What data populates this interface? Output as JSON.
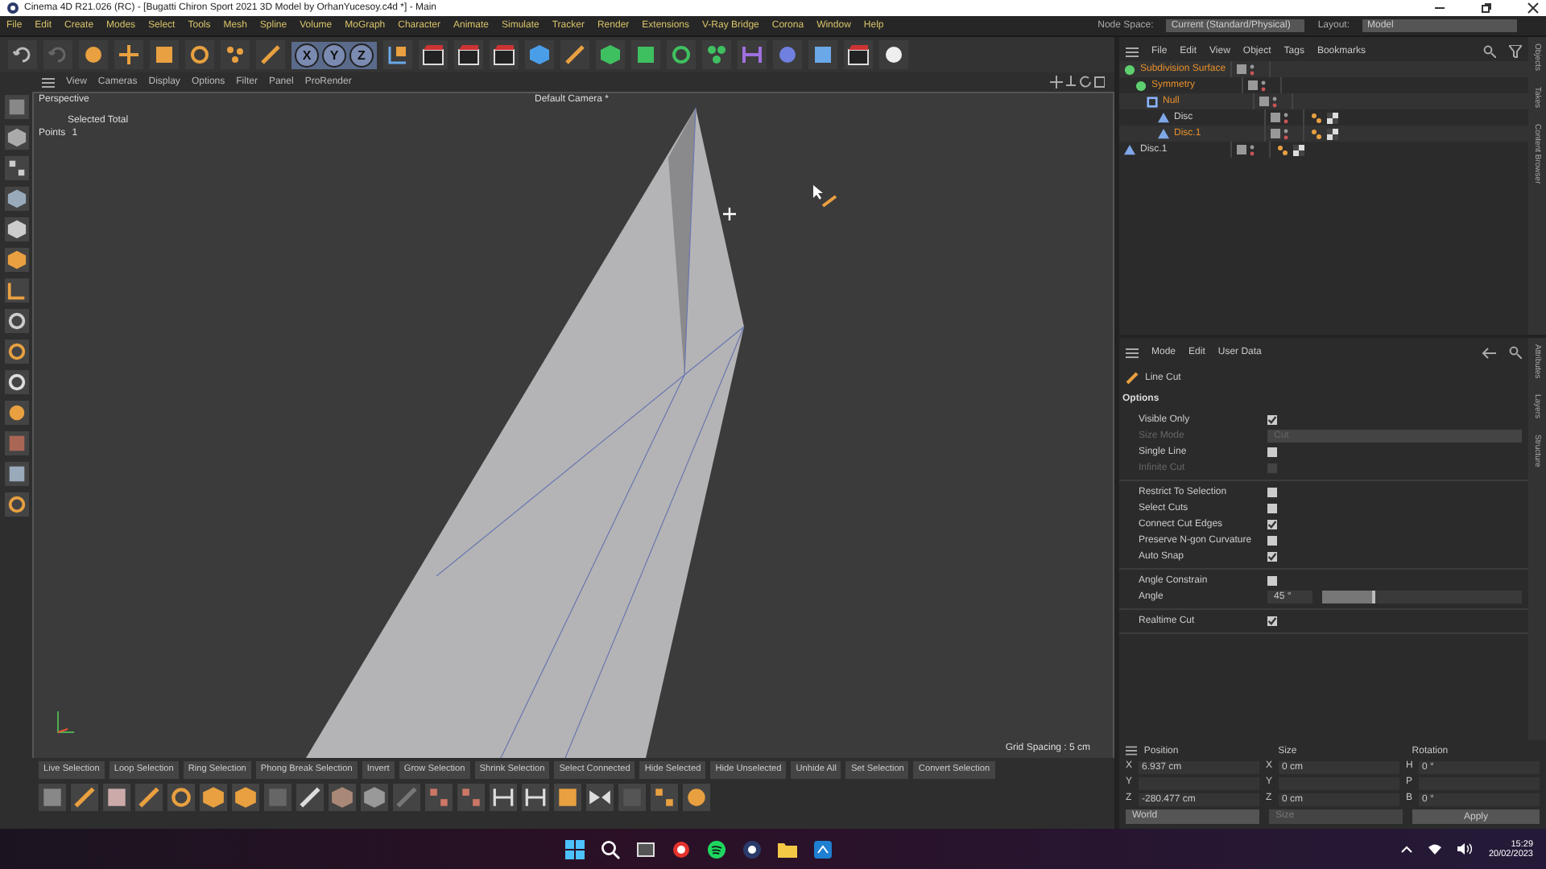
{
  "window": {
    "title": "Cinema 4D R21.026 (RC) - [Bugatti Chiron Sport 2021 3D Model by OrhanYucesoy.c4d *] - Main"
  },
  "menu": [
    "File",
    "Edit",
    "Create",
    "Modes",
    "Select",
    "Tools",
    "Mesh",
    "Spline",
    "Volume",
    "MoGraph",
    "Character",
    "Animate",
    "Simulate",
    "Tracker",
    "Render",
    "Extensions",
    "V-Ray Bridge",
    "Corona",
    "Window",
    "Help"
  ],
  "node_space": {
    "label": "Node Space:",
    "value": "Current (Standard/Physical)"
  },
  "layout": {
    "label": "Layout:",
    "value": "Model"
  },
  "axis_buttons": [
    "X",
    "Y",
    "Z"
  ],
  "viewport": {
    "menu": [
      "View",
      "Cameras",
      "Display",
      "Options",
      "Filter",
      "Panel",
      "ProRender"
    ],
    "view_name": "Perspective",
    "camera": "Default Camera *",
    "stats": [
      {
        "label": "Selected Total"
      },
      {
        "label": "Points",
        "value": "1"
      }
    ],
    "grid_spacing": "Grid Spacing : 5 cm"
  },
  "selection_tools": [
    "Live Selection",
    "Loop Selection",
    "Ring Selection",
    "Phong Break Selection",
    "Invert",
    "Grow Selection",
    "Shrink Selection",
    "Select Connected",
    "Hide Selected",
    "Hide Unselected",
    "Unhide All",
    "Set Selection",
    "Convert Selection"
  ],
  "objects": {
    "menu": [
      "File",
      "Edit",
      "View",
      "Object",
      "Tags",
      "Bookmarks"
    ],
    "tree": [
      {
        "name": "Subdivision Surface",
        "kind": "subdivision",
        "selected": true,
        "tagged": false,
        "children": [
          {
            "name": "Symmetry",
            "kind": "symmetry",
            "selected": true,
            "tagged": false,
            "children": [
              {
                "name": "Null",
                "kind": "null",
                "selected": true,
                "tagged": false,
                "children": [
                  {
                    "name": "Disc",
                    "kind": "disc",
                    "selected": false,
                    "tagged": true
                  },
                  {
                    "name": "Disc.1",
                    "kind": "disc",
                    "selected": true,
                    "tagged": true
                  }
                ]
              }
            ]
          }
        ]
      },
      {
        "name": "Disc.1",
        "kind": "disc",
        "selected": false,
        "tagged": true
      }
    ],
    "side_tabs": [
      "Objects",
      "Takes",
      "Content Browser"
    ]
  },
  "attributes": {
    "menu": [
      "Mode",
      "Edit",
      "User Data"
    ],
    "tool": "Line Cut",
    "section": "Options",
    "groups": [
      {
        "rows": [
          {
            "label": "Visible Only",
            "kind": "checkbox",
            "checked": true,
            "disabled": false
          },
          {
            "label": "Size Mode",
            "kind": "dropdown",
            "value": "Cut",
            "disabled": true
          },
          {
            "label": "Single Line",
            "kind": "checkbox",
            "checked": false,
            "disabled": false
          },
          {
            "label": "Infinite Cut",
            "kind": "checkbox",
            "checked": false,
            "disabled": true
          }
        ]
      },
      {
        "rows": [
          {
            "label": "Restrict To Selection",
            "kind": "checkbox",
            "checked": false,
            "disabled": false
          },
          {
            "label": "Select Cuts",
            "kind": "checkbox",
            "checked": false,
            "disabled": false
          },
          {
            "label": "Connect Cut Edges",
            "kind": "checkbox",
            "checked": true,
            "disabled": false
          },
          {
            "label": "Preserve N-gon Curvature",
            "kind": "checkbox",
            "checked": false,
            "disabled": false
          },
          {
            "label": "Auto Snap",
            "kind": "checkbox",
            "checked": true,
            "disabled": false
          }
        ]
      },
      {
        "rows": [
          {
            "label": "Angle Constrain",
            "kind": "checkbox",
            "checked": false,
            "disabled": false
          },
          {
            "label": "Angle",
            "kind": "slider",
            "value": "45 °",
            "level": 0.25,
            "disabled": false
          }
        ]
      },
      {
        "rows": [
          {
            "label": "Realtime Cut",
            "kind": "checkbox",
            "checked": true,
            "disabled": false
          }
        ]
      }
    ],
    "side_tabs": [
      "Attributes",
      "Layers",
      "Structure"
    ]
  },
  "coordinates": {
    "headers": [
      "Position",
      "Size",
      "Rotation"
    ],
    "rows": [
      {
        "cells": [
          {
            "axis": "X",
            "value": "6.937 cm"
          },
          {
            "axis": "X",
            "value": "0 cm"
          },
          {
            "axis": "H",
            "value": "0 °"
          }
        ]
      },
      {
        "cells": [
          {
            "axis": "Y"
          },
          {
            "axis": "Y"
          },
          {
            "axis": "P"
          }
        ]
      },
      {
        "cells": [
          {
            "axis": "Z",
            "value": "-280.477 cm"
          },
          {
            "axis": "Z",
            "value": "0 cm"
          },
          {
            "axis": "B",
            "value": "0 °"
          }
        ]
      }
    ],
    "mode": "World",
    "size_mode": "Size",
    "apply": "Apply"
  },
  "taskbar": {
    "time": "15:29",
    "date": "20/02/2023"
  }
}
